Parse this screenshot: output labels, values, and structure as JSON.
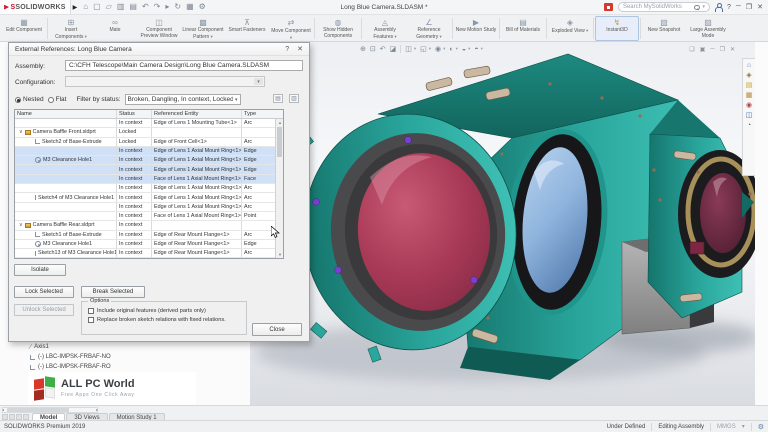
{
  "window": {
    "brand": "SOLIDWORKS",
    "title": "Long Blue Camera.SLDASM *",
    "search_placeholder": "Search MySolidWorks",
    "help_label": "?",
    "quick_access": [
      {
        "name": "home-icon",
        "glyph": "⌂"
      },
      {
        "name": "new-file-icon",
        "glyph": "▢"
      },
      {
        "name": "open-file-icon",
        "glyph": "▱"
      },
      {
        "name": "save-icon",
        "glyph": "▥"
      },
      {
        "name": "print-icon",
        "glyph": "▤"
      },
      {
        "name": "undo-icon",
        "glyph": "↶"
      },
      {
        "name": "redo-icon",
        "glyph": "↷"
      },
      {
        "name": "select-icon",
        "glyph": "▸"
      },
      {
        "name": "rebuild-icon",
        "glyph": "↻"
      },
      {
        "name": "file-properties-icon",
        "glyph": "▦"
      },
      {
        "name": "options-icon",
        "glyph": "⚙"
      }
    ],
    "window_controls": [
      {
        "name": "minimize-button",
        "glyph": "─"
      },
      {
        "name": "restore-button",
        "glyph": "❐"
      },
      {
        "name": "close-button",
        "glyph": "✕"
      }
    ]
  },
  "ribbon": {
    "buttons": [
      {
        "label": "Edit Component",
        "icon": "edit-component",
        "glyph": "▦",
        "dropdown": false,
        "active": false,
        "sep_after": true
      },
      {
        "label": "Insert Components",
        "icon": "insert-components",
        "glyph": "⊞",
        "dropdown": true,
        "active": false,
        "sep_after": false
      },
      {
        "label": "Mate",
        "icon": "mate",
        "glyph": "∞",
        "dropdown": false,
        "active": false,
        "sep_after": false
      },
      {
        "label": "Component Preview Window",
        "icon": "component-preview-window",
        "glyph": "◫",
        "dropdown": false,
        "active": false,
        "sep_after": false
      },
      {
        "label": "Linear Component Pattern",
        "icon": "linear-component-pattern",
        "glyph": "▩",
        "dropdown": true,
        "active": false,
        "sep_after": false
      },
      {
        "label": "Smart Fasteners",
        "icon": "smart-fasteners",
        "glyph": "⊼",
        "dropdown": false,
        "active": false,
        "sep_after": false
      },
      {
        "label": "Move Component",
        "icon": "move-component",
        "glyph": "⇄",
        "dropdown": true,
        "active": false,
        "sep_after": true
      },
      {
        "label": "Show Hidden Components",
        "icon": "show-hidden-components",
        "glyph": "◍",
        "dropdown": false,
        "active": false,
        "sep_after": true
      },
      {
        "label": "Assembly Features",
        "icon": "assembly-features",
        "glyph": "◬",
        "dropdown": true,
        "active": false,
        "sep_after": false
      },
      {
        "label": "Reference Geometry",
        "icon": "reference-geometry",
        "glyph": "∠",
        "dropdown": true,
        "active": false,
        "sep_after": true
      },
      {
        "label": "New Motion Study",
        "icon": "new-motion-study",
        "glyph": "▶",
        "dropdown": false,
        "active": false,
        "sep_after": true
      },
      {
        "label": "Bill of Materials",
        "icon": "bill-of-materials",
        "glyph": "▤",
        "dropdown": false,
        "active": false,
        "sep_after": true
      },
      {
        "label": "Exploded View",
        "icon": "exploded-view",
        "glyph": "◈",
        "dropdown": true,
        "active": false,
        "sep_after": true
      },
      {
        "label": "Instant3D",
        "icon": "instant3d",
        "glyph": "↯",
        "dropdown": false,
        "active": true,
        "sep_after": true
      },
      {
        "label": "New Snapshot",
        "icon": "new-snapshot",
        "glyph": "▧",
        "dropdown": false,
        "active": false,
        "sep_after": false
      },
      {
        "label": "Large Assembly Mode",
        "icon": "large-assembly-mode",
        "glyph": "▨",
        "dropdown": false,
        "active": false,
        "sep_after": false
      }
    ]
  },
  "headsup": [
    {
      "name": "zoom-to-fit-icon",
      "glyph": "⊕",
      "dropdown": false
    },
    {
      "name": "zoom-to-area-icon",
      "glyph": "⊡",
      "dropdown": false
    },
    {
      "name": "previous-view-icon",
      "glyph": "↶",
      "dropdown": false
    },
    {
      "name": "section-view-icon",
      "glyph": "◪",
      "dropdown": false
    },
    {
      "name": "display-style-icon",
      "glyph": "◫",
      "dropdown": true
    },
    {
      "name": "view-orientation-icon",
      "glyph": "◱",
      "dropdown": true
    },
    {
      "name": "hide-show-items-icon",
      "glyph": "◉",
      "dropdown": true
    },
    {
      "name": "edit-appearance-icon",
      "glyph": "◐",
      "dropdown": true
    },
    {
      "name": "apply-scene-icon",
      "glyph": "◒",
      "dropdown": true
    },
    {
      "name": "view-settings-icon",
      "glyph": "◓",
      "dropdown": true
    }
  ],
  "doc_controls": [
    {
      "name": "doc-cascade-button",
      "glyph": "❏"
    },
    {
      "name": "doc-tile-button",
      "glyph": "▣"
    },
    {
      "name": "doc-minimize-button",
      "glyph": "─"
    },
    {
      "name": "doc-restore-button",
      "glyph": "❐"
    },
    {
      "name": "doc-close-button",
      "glyph": "✕"
    }
  ],
  "taskpane": [
    {
      "name": "solidworks-resources-tab",
      "glyph": "⌂",
      "color": "#5a7ca6"
    },
    {
      "name": "design-library-tab",
      "glyph": "◈",
      "color": "#8a7448"
    },
    {
      "name": "file-explorer-tab",
      "glyph": "▤",
      "color": "#c9a227"
    },
    {
      "name": "view-palette-tab",
      "glyph": "▦",
      "color": "#b38a3c"
    },
    {
      "name": "appearances-scenes-tab",
      "glyph": "◉",
      "color": "#bb4444"
    },
    {
      "name": "custom-properties-tab",
      "glyph": "◫",
      "color": "#4466aa"
    },
    {
      "name": "forum-tab",
      "glyph": "◔",
      "color": "#447744"
    }
  ],
  "dialog": {
    "title": "External References: Long Blue Camera",
    "help_button": "?",
    "close_x": "✕",
    "assembly_label": "Assembly:",
    "assembly_value": "C:\\CFH Telescope\\Main Camera Design\\Long Blue Camera.SLDASM",
    "configuration_label": "Configuration:",
    "radio_nested": "Nested",
    "radio_flat": "Flat",
    "filter_label": "Filter by status:",
    "filter_value": "Broken, Dangling, In context, Locked...",
    "columns": [
      "Name",
      "Status",
      "Referenced Entity",
      "Type"
    ],
    "rows": [
      {
        "name": "",
        "icon": "",
        "indent": 0,
        "expander": false,
        "selected": false,
        "status": "In context",
        "entity": "Edge of Lens 1 Mounting Tube<1>",
        "type": "Arc"
      },
      {
        "name": "Camera Baffle Front.sldprt",
        "icon": "part",
        "indent": 0,
        "expander": true,
        "selected": false,
        "status": "Locked",
        "entity": "",
        "type": ""
      },
      {
        "name": "Sketch2  of  Base-Extrude",
        "icon": "sketch",
        "indent": 1,
        "expander": false,
        "selected": false,
        "status": "Locked",
        "entity": "Edge of Front Cell<1>",
        "type": "Arc"
      },
      {
        "name": "",
        "icon": "",
        "indent": 1,
        "expander": false,
        "selected": true,
        "status": "In context",
        "entity": "Edge of Lens 1 Axial Mount Ring<1>",
        "type": "Edge"
      },
      {
        "name": "M3 Clearance Hole1",
        "icon": "hole",
        "indent": 1,
        "expander": false,
        "selected": true,
        "status": "In context",
        "entity": "Edge of Lens 1 Axial Mount Ring<1>",
        "type": "Edge"
      },
      {
        "name": "",
        "icon": "",
        "indent": 1,
        "expander": false,
        "selected": true,
        "status": "In context",
        "entity": "Edge of Lens 1 Axial Mount Ring<1>",
        "type": "Edge"
      },
      {
        "name": "",
        "icon": "",
        "indent": 1,
        "expander": false,
        "selected": true,
        "status": "In context",
        "entity": "Face of Lens 1 Axial Mount Ring<1>",
        "type": "Face"
      },
      {
        "name": "",
        "icon": "",
        "indent": 1,
        "expander": false,
        "selected": false,
        "status": "In context",
        "entity": "Edge of Lens 1 Axial Mount Ring<1>",
        "type": "Arc"
      },
      {
        "name": "Sketch4  of  M3 Clearance Hole1",
        "icon": "sketch",
        "indent": 1,
        "expander": false,
        "selected": false,
        "status": "In context",
        "entity": "Edge of Lens 1 Axial Mount Ring<1>",
        "type": "Arc"
      },
      {
        "name": "",
        "icon": "",
        "indent": 1,
        "expander": false,
        "selected": false,
        "status": "In context",
        "entity": "Edge of Lens 1 Axial Mount Ring<1>",
        "type": "Arc"
      },
      {
        "name": "",
        "icon": "",
        "indent": 1,
        "expander": false,
        "selected": false,
        "status": "In context",
        "entity": "Face of Lens 1 Axial Mount Ring<1>",
        "type": "Point"
      },
      {
        "name": "Camera Baffle Rear.sldprt",
        "icon": "part",
        "indent": 0,
        "expander": true,
        "selected": false,
        "status": "In context",
        "entity": "",
        "type": ""
      },
      {
        "name": "Sketch1  of  Base-Extrude",
        "icon": "sketch",
        "indent": 1,
        "expander": false,
        "selected": false,
        "status": "In context",
        "entity": "Edge of Rear Mount Flange<1>",
        "type": "Arc"
      },
      {
        "name": "M3 Clearance Hole1",
        "icon": "hole",
        "indent": 1,
        "expander": false,
        "selected": false,
        "status": "In context",
        "entity": "Edge of Rear Mount Flange<1>",
        "type": "Edge"
      },
      {
        "name": "Sketch13  of  M3 Clearance Hole1",
        "icon": "sketch",
        "indent": 1,
        "expander": false,
        "selected": false,
        "status": "In context",
        "entity": "Edge of Rear Mount Flange<1>",
        "type": "Arc"
      }
    ],
    "isolate": "Isolate",
    "lock_selected": "Lock Selected",
    "break_selected": "Break Selected",
    "unlock_selected": "Unlock Selected",
    "options_label": "Options",
    "option_1": "Include original features (derived parts only)",
    "option_2": "Replace broken sketch relations with fixed relations.",
    "close": "Close"
  },
  "tree": {
    "items": [
      {
        "label": "Axis1",
        "icon": "axis"
      },
      {
        "label": "(-) LBC-IMPSK-FRBAF-NO",
        "icon": "sketch"
      },
      {
        "label": "(-) LBC-IMPSK-FRBAF-RO",
        "icon": "sketch"
      }
    ]
  },
  "watermark": {
    "title": "ALL PC World",
    "subtitle": "Free Apps One Click Away"
  },
  "bottom_tabs": [
    {
      "label": "Model",
      "active": true
    },
    {
      "label": "3D Views",
      "active": false
    },
    {
      "label": "Motion Study 1",
      "active": false
    }
  ],
  "statusbar": {
    "left": "SOLIDWORKS Premium 2019",
    "items": [
      {
        "label": "Under Defined",
        "muted": false
      },
      {
        "label": "Editing Assembly",
        "muted": false
      },
      {
        "label": "MMGS",
        "muted": true
      }
    ]
  },
  "colors": {
    "body_teal": "#2aa79d",
    "body_teal_dark": "#15756c",
    "lens_red": "#a93a57",
    "lens_blue": "#8fb4dd",
    "lens_small_maroon": "#5c2138",
    "brass_ring": "#a8905a",
    "mount_gray": "#9b9b9b",
    "selection_row": "#cfe0f7",
    "brand_red": "#c8102e"
  }
}
